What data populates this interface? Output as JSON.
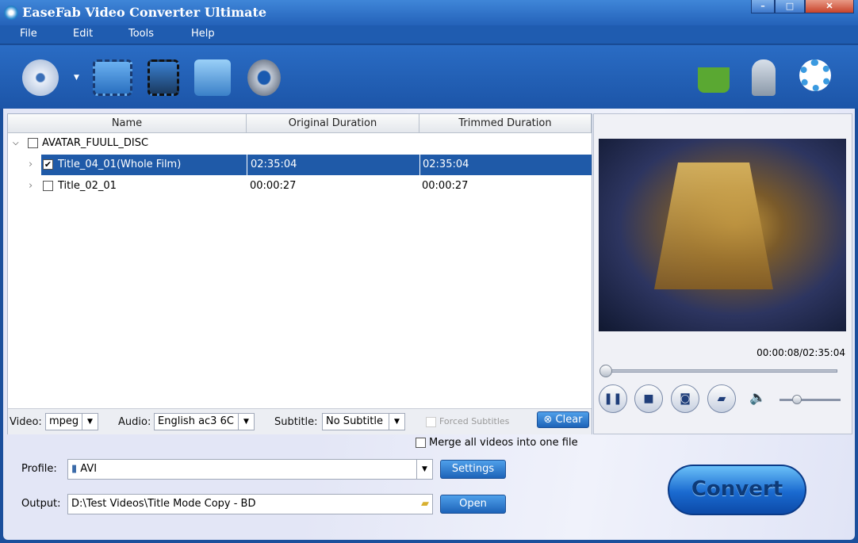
{
  "window": {
    "title": "EaseFab Video Converter Ultimate"
  },
  "menu": [
    "File",
    "Edit",
    "Tools",
    "Help"
  ],
  "toolbar": {
    "left": [
      "add-dvd-icon",
      "add-video-icon",
      "edit-video-icon",
      "convert-disc-icon",
      "settings-gear-icon"
    ],
    "right": [
      "shop-basket-icon",
      "register-key-icon",
      "help-lifebuoy-icon"
    ]
  },
  "list": {
    "headers": [
      "Name",
      "Original Duration",
      "Trimmed Duration"
    ],
    "group": {
      "name": "AVATAR_FUULL_DISC",
      "checked": false
    },
    "rows": [
      {
        "name": "Title_04_01(Whole Film)",
        "original": "02:35:04",
        "trimmed": "02:35:04",
        "checked": true,
        "selected": true
      },
      {
        "name": "Title_02_01",
        "original": "00:00:27",
        "trimmed": "00:00:27",
        "checked": false,
        "selected": false
      }
    ]
  },
  "options": {
    "video_label": "Video:",
    "video_value": "mpeg",
    "audio_label": "Audio:",
    "audio_value": "English ac3 6C",
    "subtitle_label": "Subtitle:",
    "subtitle_value": "No Subtitle",
    "forced_label": "Forced Subtitles",
    "clear_label": "Clear"
  },
  "preview": {
    "time": "00:00:08/02:35:04",
    "progress": 0.001,
    "volume": 0.25
  },
  "merge_label": "Merge all videos into one file",
  "profile": {
    "label": "Profile:",
    "value": "AVI",
    "settings_label": "Settings"
  },
  "output": {
    "label": "Output:",
    "value": "D:\\Test Videos\\Title Mode Copy - BD",
    "open_label": "Open"
  },
  "convert_label": "Convert",
  "colors": {
    "accent": "#1f5aa8",
    "titlebar": "#2f72c8"
  }
}
